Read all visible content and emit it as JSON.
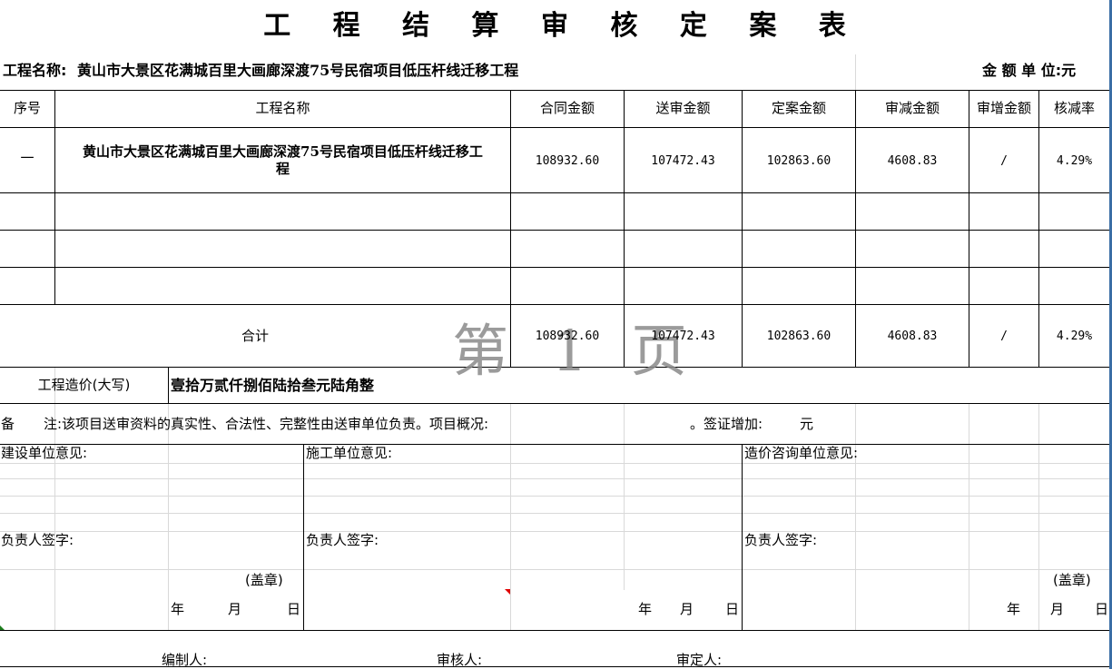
{
  "title": "工 程 结 算 审 核 定 案 表",
  "project_line": {
    "label": "工程名称:",
    "name": "黄山市大景区花满城百里大画廊深渡75号民宿项目低压杆线迁移工程",
    "unit": "金 额 单 位:元"
  },
  "headers": [
    "序号",
    "工程名称",
    "合同金额",
    "送审金额",
    "定案金额",
    "审减金额",
    "审增金额",
    "核减率"
  ],
  "rows": [
    {
      "index": "一",
      "name_line1": "黄山市大景区花满城百里大画廊深渡75号民宿项目低压杆线迁移工",
      "name_line2": "程",
      "contract": "108932.60",
      "submitted": "107472.43",
      "final": "102863.60",
      "reduced": "4608.83",
      "increased": "/",
      "rate": "4.29%"
    }
  ],
  "total": {
    "label": "合计",
    "contract": "108932.60",
    "submitted": "107472.43",
    "final": "102863.60",
    "reduced": "4608.83",
    "increased": "/",
    "rate": "4.29%"
  },
  "watermark": "第 1 页",
  "capital": {
    "label": "工程造价(大写)",
    "value": "壹拾万贰仟捌佰陆拾叁元陆角整"
  },
  "remark": {
    "label": "备",
    "text": "注:该项目送审资料的真实性、合法性、完整性由送审单位负责。项目概况:",
    "visa": "。签证增加:",
    "unit": "元"
  },
  "opinions": {
    "construction": "建设单位意见:",
    "contractor": "施工单位意见:",
    "consulting": "造价咨询单位意见:"
  },
  "signer": "负责人签字:",
  "seal": "(盖章)",
  "date": {
    "year": "年",
    "month": "月",
    "day": "日"
  },
  "footer": {
    "compiler": "编制人:",
    "reviewer": "审核人:",
    "approver": "审定人:"
  }
}
